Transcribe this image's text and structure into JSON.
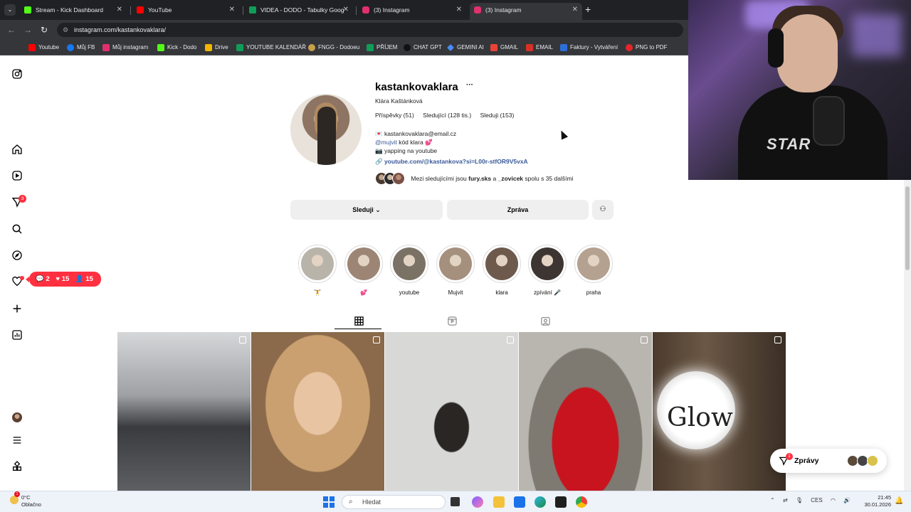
{
  "browser": {
    "tabs": [
      {
        "title": "Stream - Kick Dashboard",
        "color": "#53fc18"
      },
      {
        "title": "YouTube",
        "color": "#ff0000"
      },
      {
        "title": "VIDEA - DODO - Tabulky Goog",
        "color": "#0f9d58"
      },
      {
        "title": "(3) Instagram",
        "color": "#e1306c"
      },
      {
        "title": "(3) Instagram",
        "color": "#e1306c"
      }
    ],
    "url": "instagram.com/kastankovaklara/",
    "bookmarks": [
      "Youtube",
      "Můj FB",
      "Můj instagram",
      "Kick - Dodo",
      "Drive",
      "YOUTUBE KALENDÁŘ",
      "FNGG - Dodoeu",
      "PŘÍJEM",
      "CHAT GPT",
      "GEMINI AI",
      "GMAIL",
      "EMAIL",
      "Faktury - Vytváření",
      "PNG to PDF"
    ]
  },
  "rail": {
    "reels_badge": "3",
    "notifications": {
      "comments": "2",
      "likes": "15",
      "followers": "15"
    }
  },
  "profile": {
    "username": "kastankovaklara",
    "more": "···",
    "full_name": "Klára Kaštánková",
    "stats": {
      "posts": "Příspěvky (51)",
      "followers": "Sledující (128 tis.)",
      "following": "Sleduji (153)"
    },
    "bio_email": "kastankovaklara@email.cz",
    "bio_mention": "@mujvit",
    "bio_mention_rest": " kód klara 💕",
    "bio_line3": "📷 yapping na youtube",
    "bio_link": "youtube.com/@kastankova?si=L00r-stfOR9V5vxA",
    "followed_by_prefix": "Mezi sledujícími jsou ",
    "followed_by_a": "fury.sks",
    "followed_by_and": " a ",
    "followed_by_b": "_zovicek",
    "followed_by_suffix": " spolu s 35 dalšími",
    "follow_button": "Sleduji ⌄",
    "message_button": "Zpráva"
  },
  "highlights": [
    {
      "label": "🏋",
      "color": "#b9b4aa"
    },
    {
      "label": "💕",
      "color": "#9c8575"
    },
    {
      "label": "youtube",
      "color": "#7b7266"
    },
    {
      "label": "Mujvit",
      "color": "#a58f7d"
    },
    {
      "label": "klara",
      "color": "#6e5a4d"
    },
    {
      "label": "zpívání 🎤",
      "color": "#3d3532"
    },
    {
      "label": "praha",
      "color": "#b5a190"
    }
  ],
  "posts": [
    {
      "alt": "gym",
      "color": "#8e8f93"
    },
    {
      "alt": "portrait",
      "color": "#c8a37b"
    },
    {
      "alt": "bodysuit",
      "color": "#d7d7d5"
    },
    {
      "alt": "red dress",
      "color": "#b5121b"
    },
    {
      "alt": "glow",
      "color": "#6a5a4a"
    }
  ],
  "glow_text": "Glow",
  "messages_widget": {
    "label": "Zprávy",
    "badge": "1"
  },
  "taskbar": {
    "weather_temp": "0°C",
    "weather_desc": "Oblačno",
    "weather_badge": "1",
    "search_placeholder": "Hledat",
    "lang": "CES",
    "time": "21:45",
    "date": "30.01.2026"
  }
}
